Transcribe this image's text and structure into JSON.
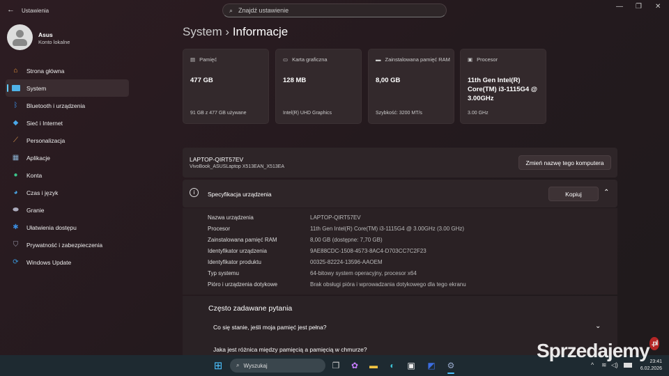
{
  "window": {
    "title": "Ustawienia",
    "search_placeholder": "Znajdź ustawienie"
  },
  "user": {
    "name": "Asus",
    "account_type": "Konto lokalne"
  },
  "sidebar": {
    "items": [
      {
        "label": "Strona główna",
        "icon": "home-icon"
      },
      {
        "label": "System",
        "icon": "monitor-icon",
        "selected": true
      },
      {
        "label": "Bluetooth i urządzenia",
        "icon": "bluetooth-icon"
      },
      {
        "label": "Sieć i Internet",
        "icon": "wifi-icon"
      },
      {
        "label": "Personalizacja",
        "icon": "brush-icon"
      },
      {
        "label": "Aplikacje",
        "icon": "apps-icon"
      },
      {
        "label": "Konta",
        "icon": "person-icon"
      },
      {
        "label": "Czas i język",
        "icon": "globe-clock-icon"
      },
      {
        "label": "Granie",
        "icon": "gamepad-icon"
      },
      {
        "label": "Ułatwienia dostępu",
        "icon": "accessibility-icon"
      },
      {
        "label": "Prywatność i zabezpieczenia",
        "icon": "shield-icon"
      },
      {
        "label": "Windows Update",
        "icon": "update-icon"
      }
    ]
  },
  "breadcrumb": {
    "parent": "System",
    "separator": "›",
    "current": "Informacje"
  },
  "cards": [
    {
      "label": "Pamięć",
      "value": "477 GB",
      "sub": "91 GB z 477 GB używane"
    },
    {
      "label": "Karta graficzna",
      "value": "128 MB",
      "sub": "Intel(R) UHD Graphics"
    },
    {
      "label": "Zainstalowana pamięć RAM",
      "value": "8,00 GB",
      "sub": "Szybkość: 3200 MT/s"
    },
    {
      "label": "Procesor",
      "value": "11th Gen Intel(R) Core(TM) i3-1115G4 @ 3.00GHz",
      "sub": "3.00 GHz"
    }
  ],
  "device": {
    "name": "LAPTOP-QIRT57EV",
    "model": "VivoBook_ASUSLaptop X513EAN_X513EA",
    "rename_button": "Zmień nazwę tego komputera"
  },
  "spec": {
    "title": "Specyfikacja urządzenia",
    "copy_button": "Kopiuj",
    "rows": [
      {
        "k": "Nazwa urządzenia",
        "v": "LAPTOP-QIRT57EV"
      },
      {
        "k": "Procesor",
        "v": "11th Gen Intel(R) Core(TM) i3-1115G4 @ 3.00GHz (3.00 GHz)"
      },
      {
        "k": "Zainstalowana pamięć RAM",
        "v": "8,00 GB (dostępne: 7,70 GB)"
      },
      {
        "k": "Identyfikator urządzenia",
        "v": "9AE88CDC-1508-4573-8AC4-D703CC7C2F23"
      },
      {
        "k": "Identyfikator produktu",
        "v": "00325-82224-13596-AAOEM"
      },
      {
        "k": "Typ systemu",
        "v": "64-bitowy system operacyjny, procesor x64"
      },
      {
        "k": "Pióro i urządzenia dotykowe",
        "v": "Brak obsługi pióra i wprowadzania dotykowego dla tego ekranu"
      }
    ]
  },
  "faq": {
    "title": "Często zadawane pytania",
    "q1": "Co się stanie, jeśli moja pamięć jest pełna?",
    "q2": "Jaka jest różnica między pamięcią a pamięcią w chmurze?"
  },
  "taskbar": {
    "search": "Wyszukaj",
    "time": "23:41",
    "date": "6.02.2026"
  },
  "watermark": "Sprzedajemy",
  "watermark_tld": ".pl"
}
